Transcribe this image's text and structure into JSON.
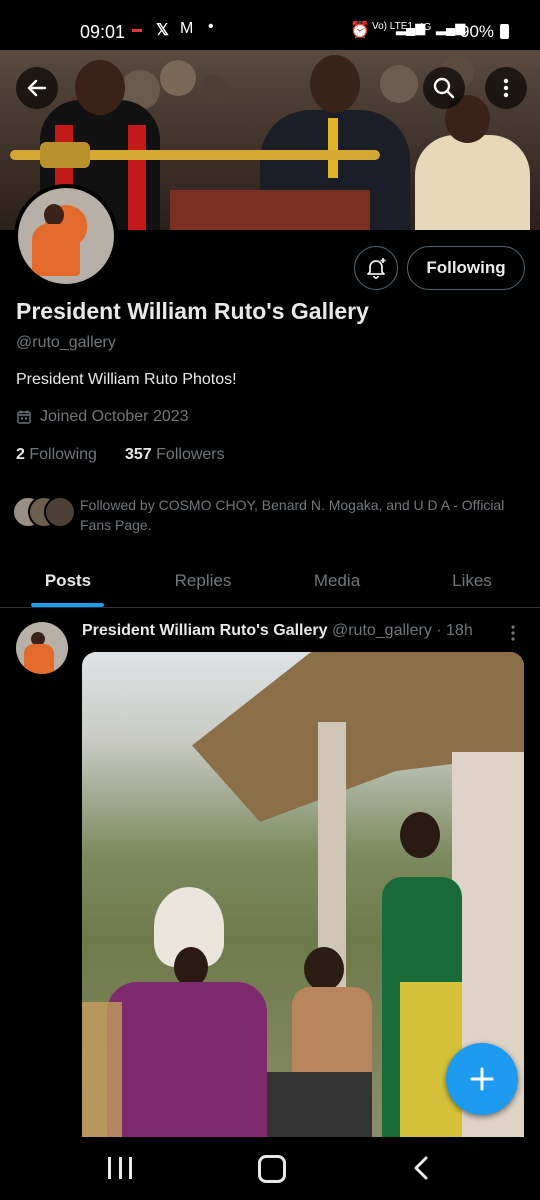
{
  "status_bar": {
    "time": "09:01",
    "network": "Vo) LTE1",
    "signal_4g": "4G",
    "battery": "90%"
  },
  "header": {
    "back_icon": "arrow-left-icon",
    "search_icon": "search-icon",
    "more_icon": "more-vertical-icon"
  },
  "profile": {
    "name": "President William Ruto's Gallery",
    "handle": "@ruto_gallery",
    "bio": "President William Ruto Photos!",
    "joined": "Joined October 2023",
    "following_count": "2",
    "following_label": "Following",
    "followers_count": "357",
    "followers_label": "Followers",
    "followed_by": "Followed by COSMO CHOY, Benard N. Mogaka, and U D A - Official Fans Page.",
    "follow_button": "Following"
  },
  "tabs": [
    {
      "label": "Posts",
      "active": true
    },
    {
      "label": "Replies",
      "active": false
    },
    {
      "label": "Media",
      "active": false
    },
    {
      "label": "Likes",
      "active": false
    }
  ],
  "post": {
    "author": "President William Ruto's Gallery",
    "handle": "@ruto_gallery",
    "time": "· 18h"
  },
  "fab": {
    "icon": "plus-icon"
  },
  "colors": {
    "accent": "#1d9bf0",
    "background": "#000000",
    "muted": "#71767b"
  }
}
